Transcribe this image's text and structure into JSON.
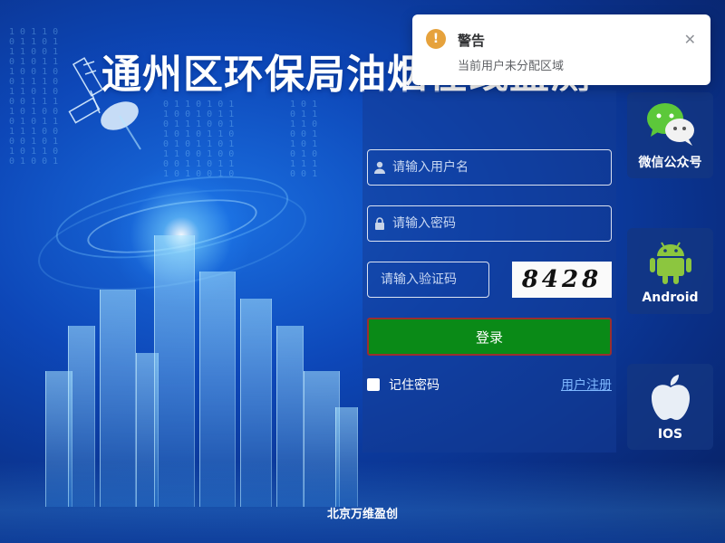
{
  "title": "通州区环保局油烟在线监测",
  "login": {
    "username_placeholder": "请输入用户名",
    "password_placeholder": "请输入密码",
    "captcha_placeholder": "请输入验证码",
    "captcha_text": "8428",
    "login_label": "登录",
    "remember_label": "记住密码",
    "register_label": "用户注册"
  },
  "apps": [
    {
      "label": "微信公众号",
      "icon": "wechat-icon"
    },
    {
      "label": "Android",
      "icon": "android-icon"
    },
    {
      "label": "IOS",
      "icon": "apple-icon"
    }
  ],
  "footer": "北京万维盈创",
  "toast": {
    "title": "警告",
    "message": "当前用户未分配区域",
    "icon": "warning-icon"
  },
  "colors": {
    "login_button": "#0a8a17",
    "warning": "#e6a23c",
    "link": "#7fb8ff"
  }
}
